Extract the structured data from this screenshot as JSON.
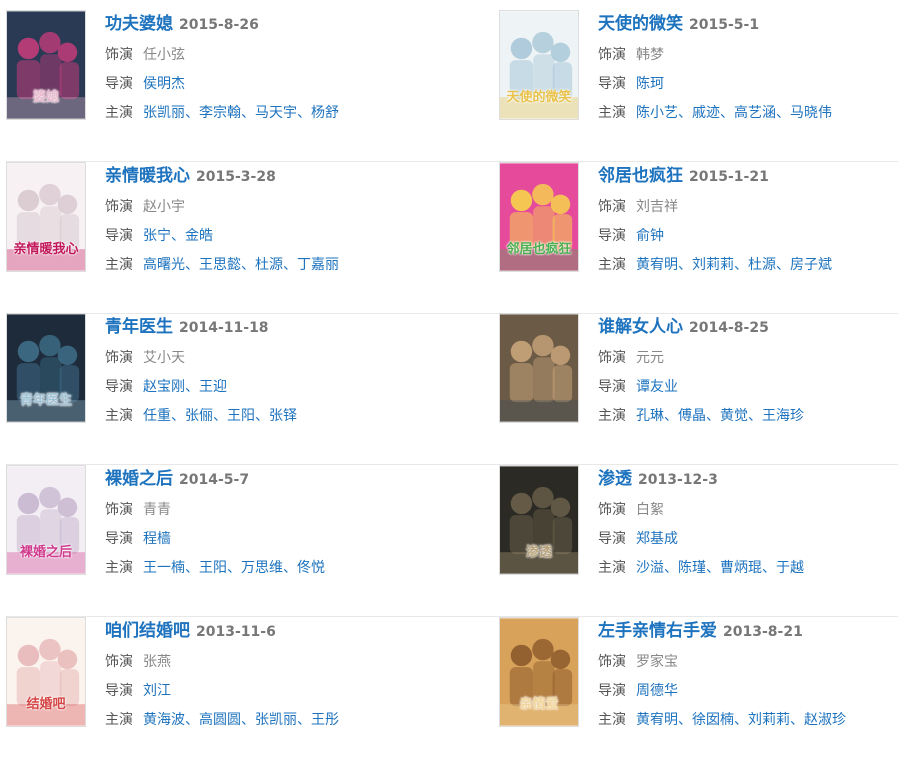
{
  "labels": {
    "role": "饰演",
    "director": "导演",
    "cast": "主演"
  },
  "rows": [
    {
      "left": {
        "title": "功夫婆媳",
        "date": "2015-8-26",
        "role": "任小弦",
        "directors": [
          "侯明杰"
        ],
        "cast": [
          "张凯丽",
          "李宗翰",
          "马天宇",
          "杨舒"
        ],
        "poster_text": "婆媳",
        "poster_colors": [
          "#2a3a55",
          "#c23c7a",
          "#e8b9cc"
        ]
      },
      "right": {
        "title": "天使的微笑",
        "date": "2015-5-1",
        "role": "韩梦",
        "directors": [
          "陈珂"
        ],
        "cast": [
          "陈小艺",
          "戚迹",
          "高艺涵",
          "马晓伟"
        ],
        "poster_text": "天使的微笑",
        "poster_colors": [
          "#eef3f6",
          "#a8c7d8",
          "#e9c24a"
        ]
      }
    },
    {
      "left": {
        "title": "亲情暖我心",
        "date": "2015-3-28",
        "role": "赵小宇",
        "directors": [
          "张宁",
          "金皓"
        ],
        "cast": [
          "高曙光",
          "王思懿",
          "杜源",
          "丁嘉丽"
        ],
        "poster_text": "亲情暖我心",
        "poster_colors": [
          "#f7f1f3",
          "#d8c9cf",
          "#c2185b"
        ]
      },
      "right": {
        "title": "邻居也疯狂",
        "date": "2015-1-21",
        "role": "刘吉祥",
        "directors": [
          "俞钟"
        ],
        "cast": [
          "黄宥明",
          "刘莉莉",
          "杜源",
          "房子斌"
        ],
        "poster_text": "邻居也疯狂",
        "poster_colors": [
          "#e64a9b",
          "#f6d44a",
          "#4caf50"
        ]
      }
    },
    {
      "left": {
        "title": "青年医生",
        "date": "2014-11-18",
        "role": "艾小天",
        "directors": [
          "赵宝刚",
          "王迎"
        ],
        "cast": [
          "任重",
          "张俪",
          "王阳",
          "张铎"
        ],
        "poster_text": "青年医生",
        "poster_colors": [
          "#1d2b3a",
          "#3f6e8a",
          "#9fc3d6"
        ]
      },
      "right": {
        "title": "谁解女人心",
        "date": "2014-8-25",
        "role": "元元",
        "directors": [
          "谭友业"
        ],
        "cast": [
          "孔琳",
          "傅晶",
          "黄觉",
          "王海珍"
        ],
        "poster_text": "",
        "poster_colors": [
          "#6b5a46",
          "#c9a57a",
          "#3d4f5c"
        ]
      }
    },
    {
      "left": {
        "title": "裸婚之后",
        "date": "2014-5-7",
        "role": "青青",
        "directors": [
          "程樯"
        ],
        "cast": [
          "王一楠",
          "王阳",
          "万思维",
          "佟悦"
        ],
        "poster_text": "裸婚之后",
        "poster_colors": [
          "#f3eef4",
          "#c7b6cf",
          "#d03a8c"
        ]
      },
      "right": {
        "title": "渗透",
        "date": "2013-12-3",
        "role": "白絮",
        "directors": [
          "郑基成"
        ],
        "cast": [
          "沙溢",
          "陈瑾",
          "曹炳琨",
          "于越"
        ],
        "poster_text": "渗透",
        "poster_colors": [
          "#2b2a24",
          "#6a5f4a",
          "#b8a27a"
        ]
      }
    },
    {
      "left": {
        "title": "咱们结婚吧",
        "date": "2013-11-6",
        "role": "张燕",
        "directors": [
          "刘江"
        ],
        "cast": [
          "黄海波",
          "高圆圆",
          "张凯丽",
          "王彤"
        ],
        "poster_text": "结婚吧",
        "poster_colors": [
          "#fbf3ee",
          "#e7b7b7",
          "#d64545"
        ]
      },
      "right": {
        "title": "左手亲情右手爱",
        "date": "2013-8-21",
        "role": "罗家宝",
        "directors": [
          "周德华"
        ],
        "cast": [
          "黄宥明",
          "徐囡楠",
          "刘莉莉",
          "赵淑珍"
        ],
        "poster_text": "亲情爱",
        "poster_colors": [
          "#d9a25a",
          "#8b5a2b",
          "#f1d49a"
        ]
      }
    }
  ]
}
